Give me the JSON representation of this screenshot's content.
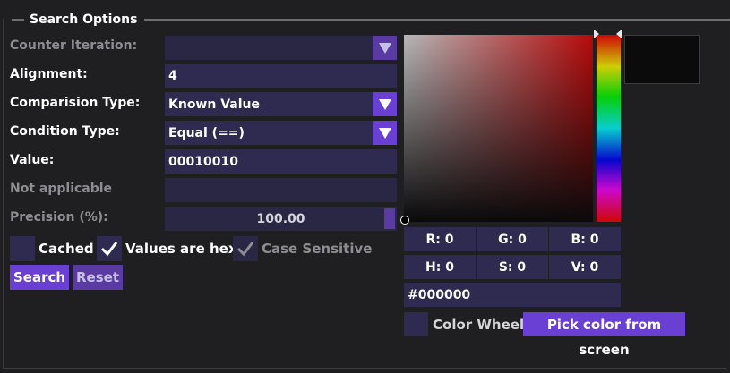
{
  "group": {
    "title": "Search Options"
  },
  "form": {
    "counter_iteration": {
      "label": "Counter Iteration:",
      "value": ""
    },
    "alignment": {
      "label": "Alignment:",
      "value": "4"
    },
    "comparison_type": {
      "label": "Comparision Type:",
      "value": "Known Value"
    },
    "condition_type": {
      "label": "Condition Type:",
      "value": "Equal (==)"
    },
    "value": {
      "label": "Value:",
      "value": "00010010"
    },
    "not_applicable": {
      "label": "Not applicable",
      "value": ""
    },
    "precision": {
      "label": "Precision (%):",
      "value": "100.00",
      "level": 1.0
    }
  },
  "checkboxes": {
    "cached": {
      "label": "Cached",
      "checked": false
    },
    "values_are_hex": {
      "label": "Values are hex",
      "checked": true
    },
    "case_sensitive": {
      "label": "Case Sensitive",
      "checked": true,
      "disabled": true
    }
  },
  "buttons": {
    "search": "Search",
    "reset": "Reset"
  },
  "color_picker": {
    "r": "R: 0",
    "g": "G: 0",
    "b": "B: 0",
    "h": "H: 0",
    "s": "S: 0",
    "v": "V: 0",
    "hex": "#000000",
    "color_wheel_label": "Color Wheel",
    "pick_button": "Pick color from screen",
    "current_color": "#000000"
  },
  "colors": {
    "accent": "#6a3fd4",
    "field_bg": "#2f2a4f",
    "window_bg": "#1f1f21"
  }
}
